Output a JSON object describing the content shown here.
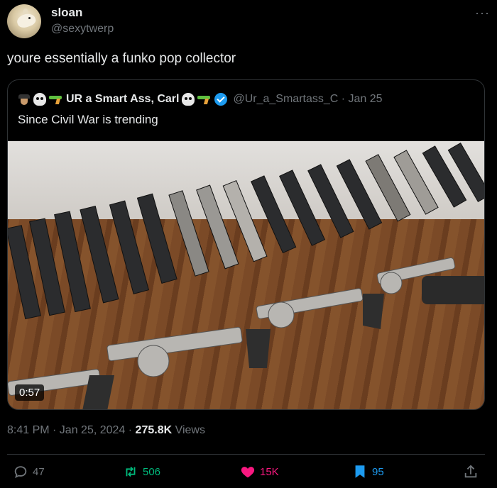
{
  "author": {
    "name": "sloan",
    "handle": "@sexytwerp",
    "more_label": "···"
  },
  "tweet": {
    "text": "youre essentially a funko pop collector"
  },
  "quote": {
    "name": "UR a Smart Ass, Carl",
    "handle": "@Ur_a_Smartass_C · Jan 25",
    "text": "Since Civil War is trending",
    "video_duration": "0:57"
  },
  "meta": {
    "time": "8:41 PM · Jan 25, 2024 · ",
    "views_count": "275.8K",
    "views_label": " Views"
  },
  "actions": {
    "replies": "47",
    "reposts": "506",
    "likes": "15K",
    "bookmarks": "95"
  },
  "colors": {
    "background": "#000000",
    "text": "#e7e9ea",
    "muted": "#71767b",
    "border": "#2f3336",
    "repost": "#00ba7c",
    "like": "#f91880",
    "bookmark": "#1d9bf0"
  },
  "icons": {
    "reply": "reply-icon",
    "repost": "repost-icon",
    "like": "heart-icon",
    "bookmark": "bookmark-icon",
    "share": "share-icon"
  }
}
